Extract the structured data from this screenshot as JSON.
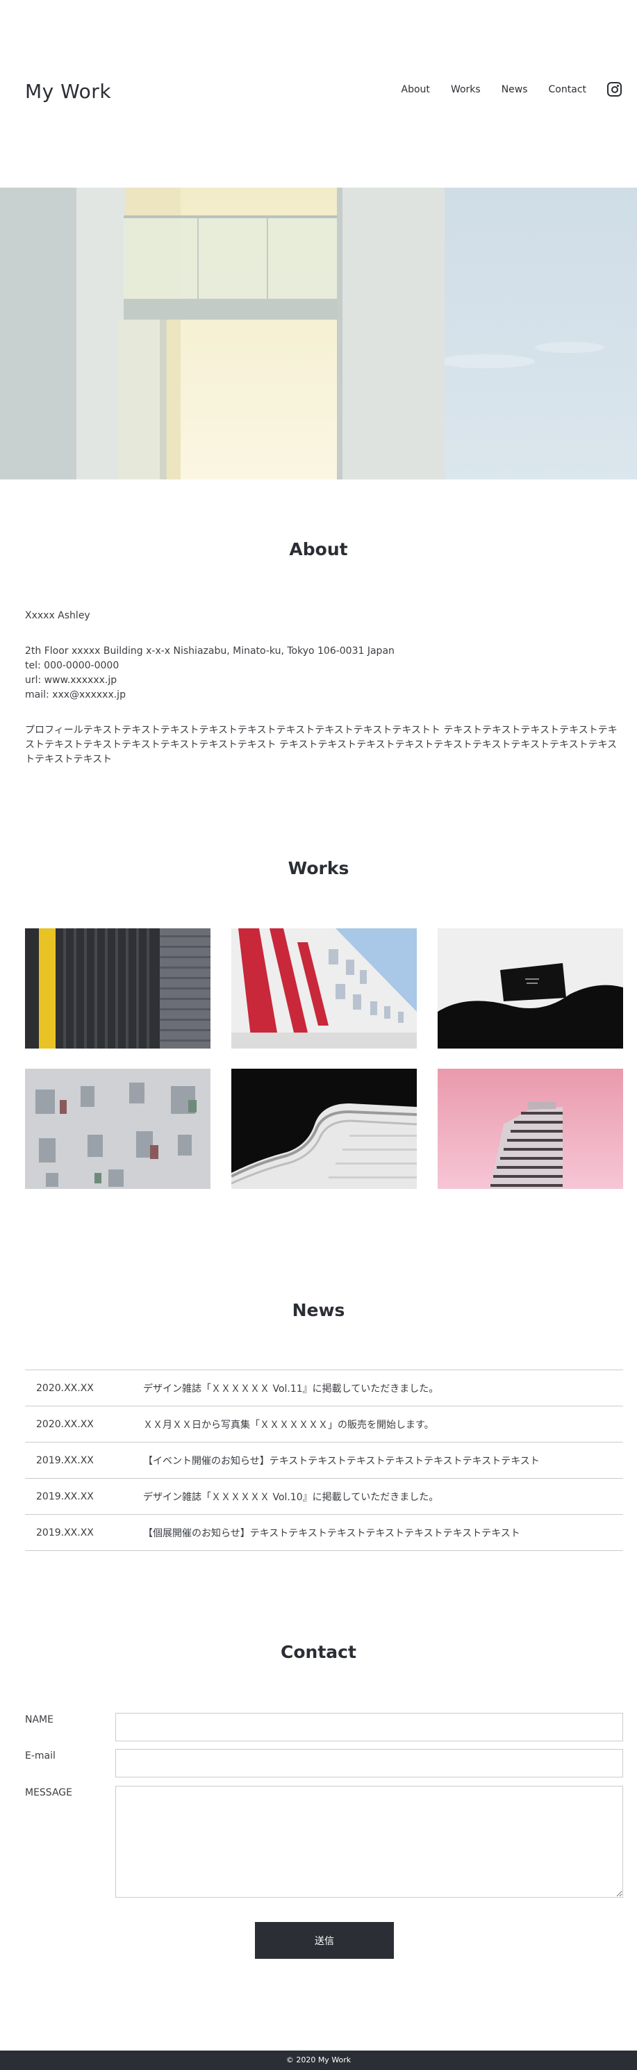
{
  "header": {
    "logo": "My Work",
    "nav": [
      "About",
      "Works",
      "News",
      "Contact"
    ],
    "social_icon": "instagram-icon"
  },
  "about": {
    "title": "About",
    "name": "Xxxxx Ashley",
    "address": "2th Floor xxxxx Building x-x-x Nishiazabu, Minato-ku, Tokyo 106-0031 Japan",
    "tel": "tel: 000-0000-0000",
    "url": "url: www.xxxxxx.jp",
    "mail": "mail: xxx@xxxxxx.jp",
    "profile": "プロフィールテキストテキストテキストテキストテキストテキストテキストテキストテキストト テキストテキストテキストテキストテキストテキストテキストテキストテキストテキストテキスト テキストテキストテキストテキストテキストテキストテキストテキストテキストテキストテキスト"
  },
  "works": {
    "title": "Works",
    "items": [
      {
        "label": "building-facade-yellow-stripe"
      },
      {
        "label": "red-white-apartments"
      },
      {
        "label": "white-curved-balcony"
      },
      {
        "label": "grey-window-facade"
      },
      {
        "label": "curved-white-building"
      },
      {
        "label": "pink-sky-tower"
      }
    ]
  },
  "news": {
    "title": "News",
    "items": [
      {
        "date": "2020.XX.XX",
        "text": "デザイン雑誌「ＸＸＸＸＸＸ Vol.11』に掲載していただきました。"
      },
      {
        "date": "2020.XX.XX",
        "text": "ＸＸ月ＸＸ日から写真集「ＸＸＸＸＸＸＸ」の販売を開始します。"
      },
      {
        "date": "2019.XX.XX",
        "text": "【イベント開催のお知らせ】テキストテキストテキストテキストテキストテキストテキスト"
      },
      {
        "date": "2019.XX.XX",
        "text": "デザイン雑誌「ＸＸＸＸＸＸ Vol.10』に掲載していただきました。"
      },
      {
        "date": "2019.XX.XX",
        "text": "【個展開催のお知らせ】テキストテキストテキストテキストテキストテキストテキスト"
      }
    ]
  },
  "contact": {
    "title": "Contact",
    "name_label": "NAME",
    "email_label": "E-mail",
    "message_label": "MESSAGE",
    "name_value": "",
    "email_value": "",
    "message_value": "",
    "submit_label": "送信"
  },
  "footer": {
    "copyright": "© 2020 My Work"
  }
}
